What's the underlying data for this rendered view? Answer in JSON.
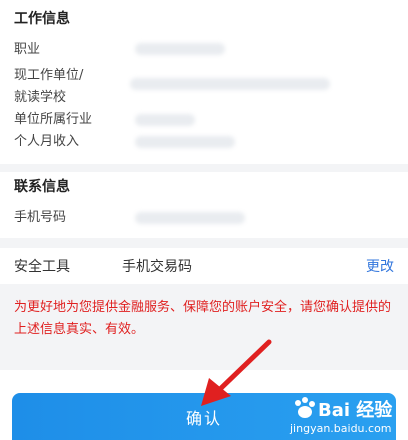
{
  "work_info": {
    "title": "工作信息",
    "rows": [
      {
        "label": "职业"
      },
      {
        "label": "现工作单位/"
      },
      {
        "label": "就读学校"
      },
      {
        "label": "单位所属行业"
      },
      {
        "label": "个人月收入"
      }
    ]
  },
  "contact_info": {
    "title": "联系信息",
    "phone_label": "手机号码"
  },
  "security": {
    "label": "安全工具",
    "value": "手机交易码",
    "action": "更改"
  },
  "notice": "为更好地为您提供金融服务、保障您的账户安全，请您确认提供的上述信息真实、有效。",
  "confirm_button": "确认",
  "watermark": {
    "brand": "Bai 经验",
    "url": "jingyan.baidu.com"
  },
  "colors": {
    "accent": "#2a9ef0",
    "link": "#3377dd",
    "notice_text": "#e02020",
    "arrow": "#e02020"
  }
}
